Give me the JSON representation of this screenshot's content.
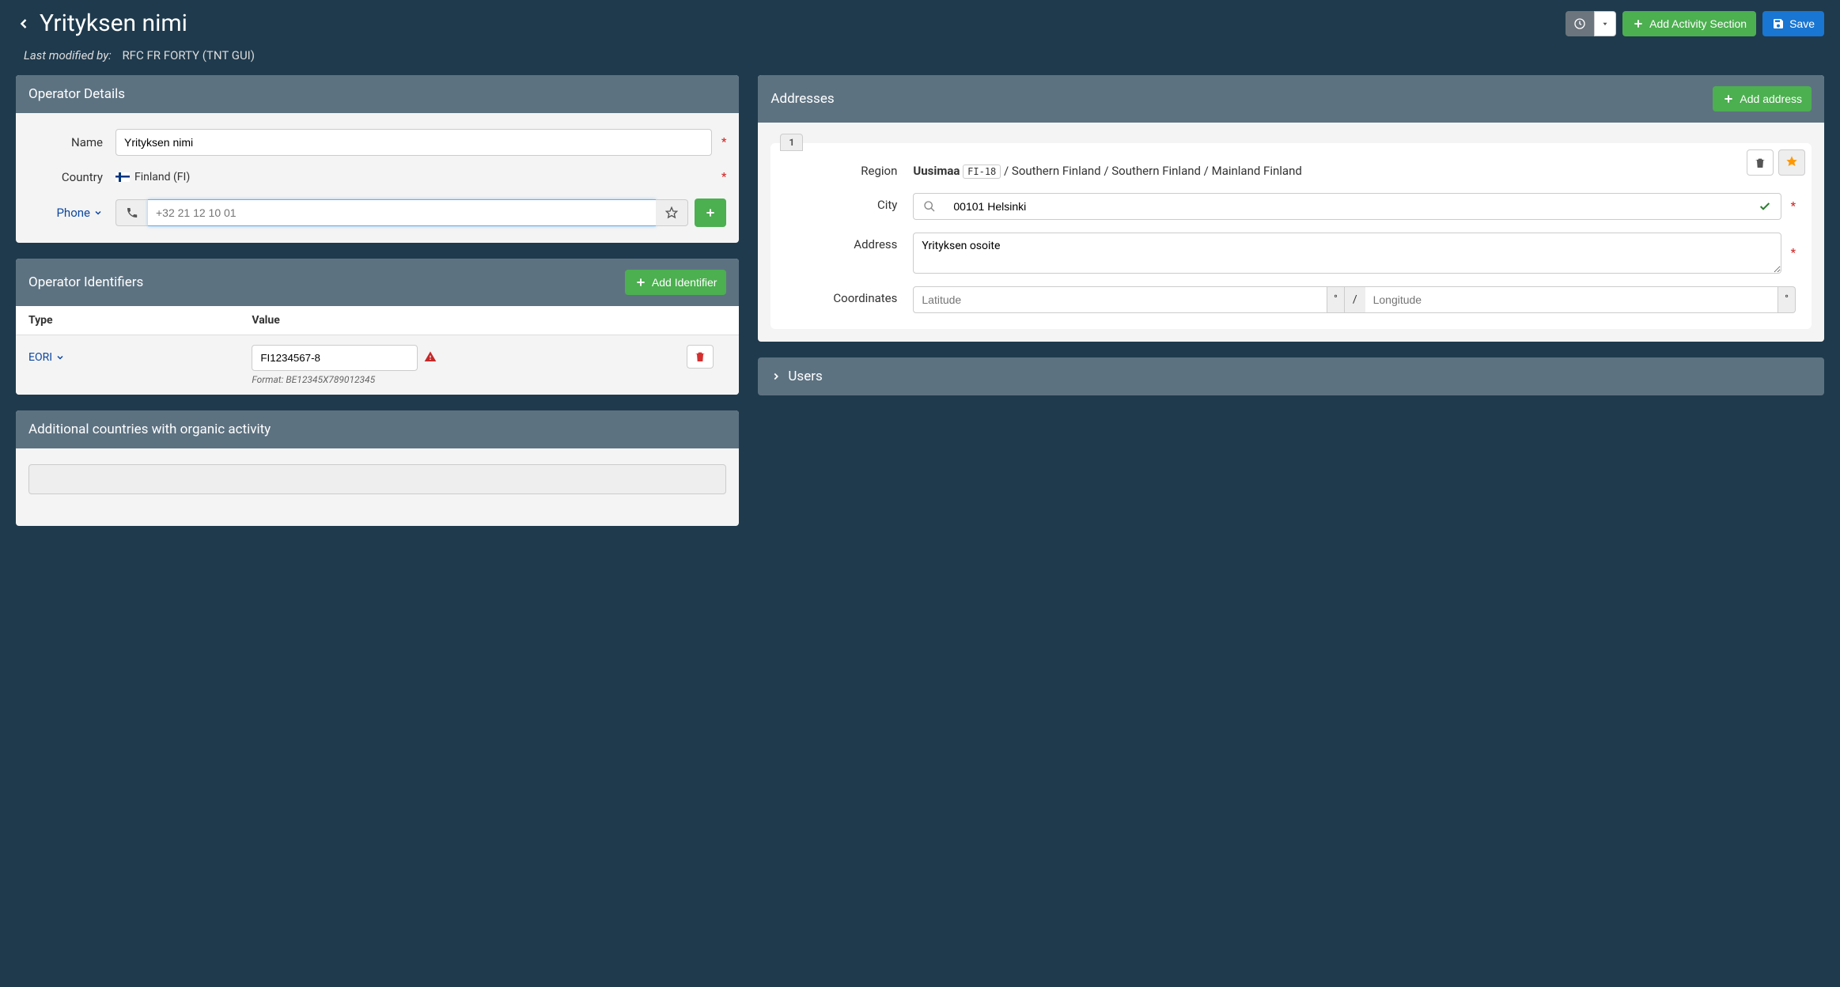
{
  "header": {
    "title": "Yrityksen nimi",
    "last_modified_label": "Last modified by:",
    "last_modified_value": "RFC FR FORTY (TNT GUI)",
    "add_activity_btn": "Add Activity Section",
    "save_btn": "Save"
  },
  "operator_details": {
    "panel_title": "Operator Details",
    "name_label": "Name",
    "name_value": "Yrityksen nimi",
    "country_label": "Country",
    "country_value": "Finland (FI)",
    "phone_label": "Phone",
    "phone_placeholder": "+32 21 12 10 01"
  },
  "identifiers": {
    "panel_title": "Operator Identifiers",
    "add_btn": "Add Identifier",
    "col_type": "Type",
    "col_value": "Value",
    "row_type": "EORI",
    "row_value": "FI1234567-8",
    "format_hint": "Format: BE12345X789012345"
  },
  "additional": {
    "panel_title": "Additional countries with organic activity"
  },
  "addresses": {
    "panel_title": "Addresses",
    "add_btn": "Add address",
    "tab_number": "1",
    "region_label": "Region",
    "region_bold": "Uusimaa",
    "region_code": "FI-18",
    "region_rest": "/ Southern Finland / Southern Finland / Mainland Finland",
    "city_label": "City",
    "city_value": "00101 Helsinki",
    "address_label": "Address",
    "address_value": "Yrityksen osoite",
    "coords_label": "Coordinates",
    "lat_placeholder": "Latitude",
    "lng_placeholder": "Longitude",
    "coord_sep": "/"
  },
  "users": {
    "panel_title": "Users"
  }
}
